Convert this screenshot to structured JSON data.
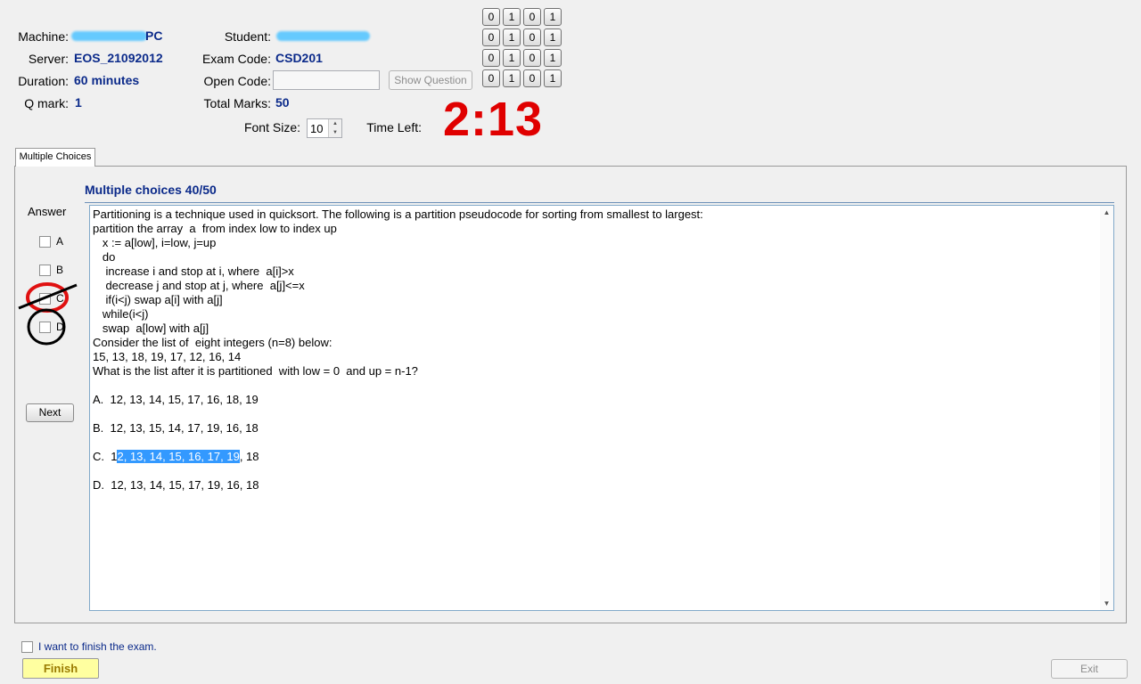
{
  "header": {
    "machine_label": "Machine:",
    "machine_value": "PC",
    "server_label": "Server:",
    "server_value": "EOS_21092012",
    "duration_label": "Duration:",
    "duration_value": "60 minutes",
    "qmark_label": "Q mark:",
    "qmark_value": "1",
    "student_label": "Student:",
    "exam_code_label": "Exam Code:",
    "exam_code_value": "CSD201",
    "open_code_label": "Open Code:",
    "open_code_value": "",
    "show_question_label": "Show Question",
    "total_marks_label": "Total Marks:",
    "total_marks_value": "50",
    "font_size_label": "Font Size:",
    "font_size_value": "10",
    "time_left_label": "Time Left:",
    "time_left_value": "2:13"
  },
  "bit_grid": [
    [
      "0",
      "1",
      "0",
      "1"
    ],
    [
      "0",
      "1",
      "0",
      "1"
    ],
    [
      "0",
      "1",
      "0",
      "1"
    ],
    [
      "0",
      "1",
      "0",
      "1"
    ]
  ],
  "tab": {
    "label": "Multiple Choices"
  },
  "question": {
    "title": "Multiple choices 40/50",
    "lines": [
      "Partitioning is a technique used in quicksort. The following is a partition pseudocode for sorting from smallest to largest:",
      "partition the array  a  from index low to index up",
      "   x := a[low], i=low, j=up",
      "   do",
      "    increase i and stop at i, where  a[i]>x",
      "    decrease j and stop at j, where  a[j]<=x",
      "    if(i<j) swap a[i] with a[j]",
      "   while(i<j)",
      "   swap  a[low] with a[j]",
      "Consider the list of  eight integers (n=8) below:",
      "15, 13, 18, 19, 17, 12, 16, 14",
      "What is the list after it is partitioned  with low = 0  and up = n-1?"
    ],
    "option_a": "A.  12, 13, 14, 15, 17, 16, 18, 19",
    "option_b": "B.  12, 13, 15, 14, 17, 19, 16, 18",
    "option_c_pre": "C.  1",
    "option_c_sel": "2, 13, 14, 15, 16, 17, 19",
    "option_c_post": ", 18",
    "option_d": "D.  12, 13, 14, 15, 17, 19, 16, 18"
  },
  "answer": {
    "label": "Answer",
    "choices": [
      "A",
      "B",
      "C",
      "D"
    ],
    "next_label": "Next"
  },
  "footer": {
    "finish_checkbox_label": "I want to finish the exam.",
    "finish_label": "Finish",
    "exit_label": "Exit"
  },
  "colors": {
    "value_text": "#0b2a8a",
    "timer": "#e00000",
    "selection": "#3399ff",
    "annotation_red": "#e01010",
    "annotation_black": "#000000",
    "finish_button": "#ffffa0"
  }
}
